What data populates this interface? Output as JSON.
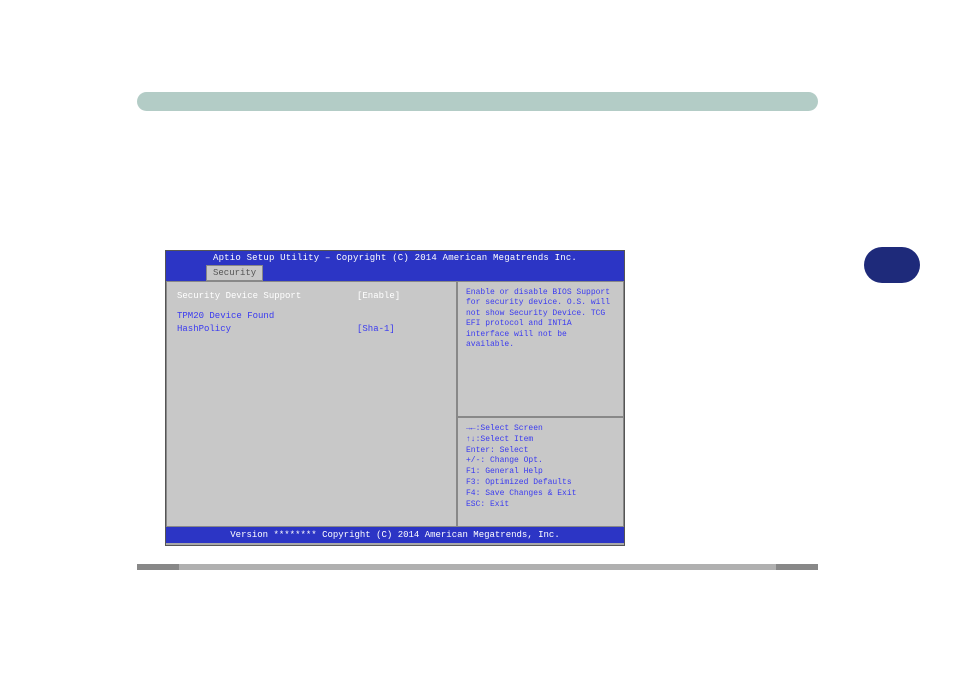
{
  "bios": {
    "title": "Aptio Setup Utility – Copyright (C) 2014 American Megatrends Inc.",
    "tab": "Security",
    "footer": "Version ******** Copyright (C) 2014 American Megatrends, Inc.",
    "settings": {
      "sds_label": "Security Device Support",
      "sds_value": "[Enable]",
      "tpm_label": "TPM20 Device Found",
      "hash_label": "HashPolicy",
      "hash_value": "[Sha-1]"
    },
    "help_text": "Enable or disable BIOS Support for security device. O.S. will not show Security Device. TCG EFI protocol and INT1A interface will not be available.",
    "keys": {
      "l1": "→←:Select Screen",
      "l2": "↑↓:Select Item",
      "l3": "Enter: Select",
      "l4": "+/-: Change Opt.",
      "l5": "F1: General Help",
      "l6": "F3: Optimized Defaults",
      "l7": "F4: Save Changes & Exit",
      "l8": "ESC: Exit"
    }
  }
}
